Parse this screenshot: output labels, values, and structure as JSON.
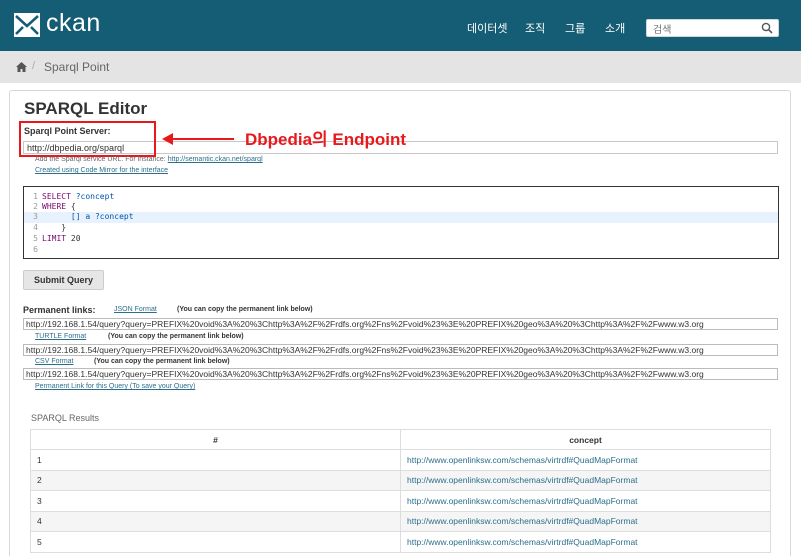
{
  "header": {
    "logo_text": "ckan",
    "nav": [
      "데이터셋",
      "조직",
      "그룹",
      "소개"
    ],
    "search_placeholder": "검색"
  },
  "breadcrumb": {
    "current": "Sparql Point",
    "separator": "/"
  },
  "editor": {
    "title": "SPARQL Editor",
    "server_label": "Sparql Point Server:",
    "server_value": "http://dbpedia.org/sparql",
    "help_prefix": "Add the Sparql service URL. For instance:",
    "help_link": "http://semantic.ckan.net/sparql",
    "codemirror_link": "Created using Code Mirror for the interface",
    "code_lines": [
      {
        "num": "1",
        "kw": "SELECT",
        "rest": " ?concept"
      },
      {
        "num": "2",
        "kw": "WHERE",
        "rest": " {"
      },
      {
        "num": "3",
        "kw": "",
        "rest": "      [] a ?concept"
      },
      {
        "num": "4",
        "kw": "",
        "rest": "    }"
      },
      {
        "num": "5",
        "kw": "LIMIT",
        "rest": " 20"
      },
      {
        "num": "6",
        "kw": "",
        "rest": ""
      }
    ],
    "submit_label": "Submit Query"
  },
  "annotation": {
    "text": "Dbpedia의 Endpoint",
    "color": "#e8191d"
  },
  "permanent": {
    "label": "Permanent links:",
    "json_label": "JSON Format",
    "json_note": "(You can copy the permanent link below)",
    "json_url": "http://192.168.1.54/query?query=PREFIX%20void%3A%20%3Chttp%3A%2F%2Frdfs.org%2Fns%2Fvoid%23%3E%20PREFIX%20geo%3A%20%3Chttp%3A%2F%2Fwww.w3.org",
    "turtle_label": "TURTLE Format",
    "turtle_note": "(You can copy the permanent link below)",
    "turtle_url": "http://192.168.1.54/query?query=PREFIX%20void%3A%20%3Chttp%3A%2F%2Frdfs.org%2Fns%2Fvoid%23%3E%20PREFIX%20geo%3A%20%3Chttp%3A%2F%2Fwww.w3.org",
    "csv_label": "CSV Format",
    "csv_note": "(You can copy the permanent link below)",
    "csv_url": "http://192.168.1.54/query?query=PREFIX%20void%3A%20%3Chttp%3A%2F%2Frdfs.org%2Fns%2Fvoid%23%3E%20PREFIX%20geo%3A%20%3Chttp%3A%2F%2Fwww.w3.org",
    "query_link": "Permanent Link for this Query (To save your Query)"
  },
  "results": {
    "title": "SPARQL Results",
    "columns": [
      "#",
      "concept"
    ],
    "rows": [
      [
        "1",
        "http://www.openlinksw.com/schemas/virtrdf#QuadMapFormat"
      ],
      [
        "2",
        "http://www.openlinksw.com/schemas/virtrdf#QuadMapFormat"
      ],
      [
        "3",
        "http://www.openlinksw.com/schemas/virtrdf#QuadMapFormat"
      ],
      [
        "4",
        "http://www.openlinksw.com/schemas/virtrdf#QuadMapFormat"
      ],
      [
        "5",
        "http://www.openlinksw.com/schemas/virtrdf#QuadMapFormat"
      ]
    ]
  },
  "colors": {
    "header_bg": "#155d74",
    "link": "#2b6f8c",
    "highlight": "#e8191d"
  }
}
